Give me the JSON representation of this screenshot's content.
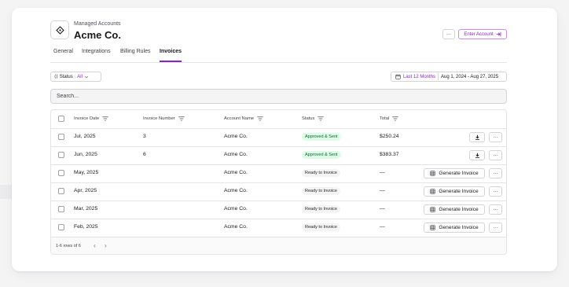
{
  "header": {
    "eyebrow": "Managed Accounts",
    "title": "Acme Co.",
    "more_label": "···",
    "enter_account_label": "Enter Account"
  },
  "tabs": [
    {
      "label": "General",
      "active": false
    },
    {
      "label": "Integrations",
      "active": false
    },
    {
      "label": "Billing Rules",
      "active": false
    },
    {
      "label": "Invoices",
      "active": true
    }
  ],
  "filters": {
    "status_label": "Status",
    "status_value": "All",
    "date_range_label": "Last 12 Months",
    "date_range_value": "Aug 1, 2024 - Aug 27, 2025"
  },
  "search": {
    "placeholder": "Search..."
  },
  "table": {
    "columns": [
      "Invoice Date",
      "Invoice Number",
      "Account Name",
      "Status",
      "Total"
    ],
    "rows": [
      {
        "date": "Jul, 2025",
        "number": "3",
        "account": "Acme Co.",
        "status": "Approved & Sent",
        "status_kind": "green",
        "total": "$250.24",
        "action": "download"
      },
      {
        "date": "Jun, 2025",
        "number": "6",
        "account": "Acme Co.",
        "status": "Approved & Sent",
        "status_kind": "green",
        "total": "$383.37",
        "action": "download"
      },
      {
        "date": "May, 2025",
        "number": "",
        "account": "Acme Co.",
        "status": "Ready to Invoice",
        "status_kind": "gray",
        "total": "—",
        "action": "generate"
      },
      {
        "date": "Apr, 2025",
        "number": "",
        "account": "Acme Co.",
        "status": "Ready to Invoice",
        "status_kind": "gray",
        "total": "—",
        "action": "generate"
      },
      {
        "date": "Mar, 2025",
        "number": "",
        "account": "Acme Co.",
        "status": "Ready to Invoice",
        "status_kind": "gray",
        "total": "—",
        "action": "generate"
      },
      {
        "date": "Feb, 2025",
        "number": "",
        "account": "Acme Co.",
        "status": "Ready to Invoice",
        "status_kind": "gray",
        "total": "—",
        "action": "generate"
      }
    ],
    "generate_label": "Generate Invoice",
    "more_label": "···",
    "footer": {
      "rows_count": "1-6 rows of 6",
      "prev": "‹",
      "next": "›"
    }
  },
  "colors": {
    "accent": "#8b24c7",
    "badge_green_bg": "#dcfce7",
    "badge_green_text": "#166534"
  },
  "icons": [
    "tag-icon",
    "enter-icon",
    "filter-icon",
    "calendar-icon",
    "sort-icon",
    "download-icon",
    "invoice-icon",
    "more-icon"
  ]
}
